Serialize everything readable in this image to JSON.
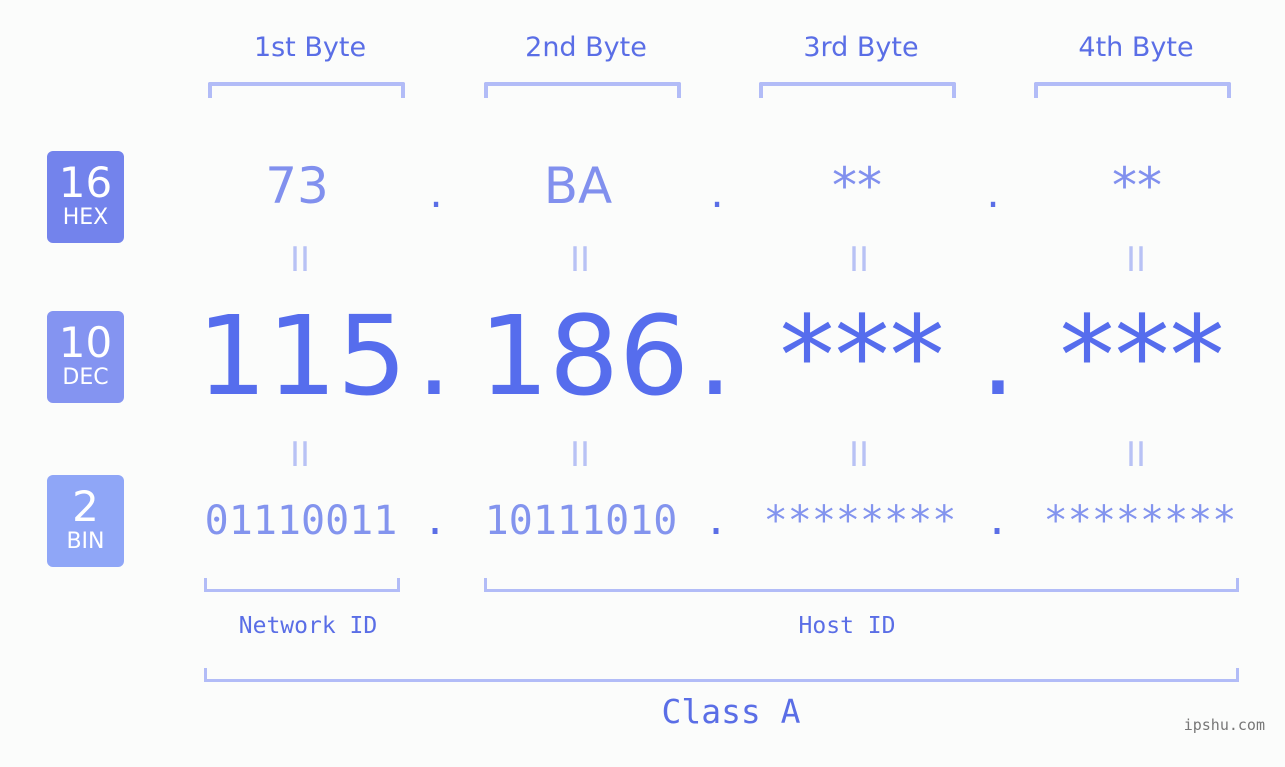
{
  "bytes": {
    "headers": [
      "1st Byte",
      "2nd Byte",
      "3rd Byte",
      "4th Byte"
    ]
  },
  "bases": {
    "hex": {
      "number": "16",
      "label": "HEX",
      "color": "#7383ec"
    },
    "dec": {
      "number": "10",
      "label": "DEC",
      "color": "#8494f1"
    },
    "bin": {
      "number": "2",
      "label": "BIN",
      "color": "#8fa6f7"
    }
  },
  "hex": {
    "values": [
      "73",
      "BA",
      "**",
      "**"
    ],
    "separator": "."
  },
  "dec": {
    "values": [
      "115",
      "186",
      "***",
      "***"
    ],
    "separator": "."
  },
  "bin": {
    "values": [
      "01110011",
      "10111010",
      "********",
      "********"
    ],
    "separator": "."
  },
  "equals_symbol": "II",
  "segments": {
    "network_id": "Network ID",
    "host_id": "Host ID"
  },
  "ip_class": "Class A",
  "watermark": "ipshu.com",
  "colors": {
    "accent": "#566ded",
    "light_accent": "#8190ee",
    "bracket": "#b2bcf7",
    "background": "#fbfcfb"
  }
}
